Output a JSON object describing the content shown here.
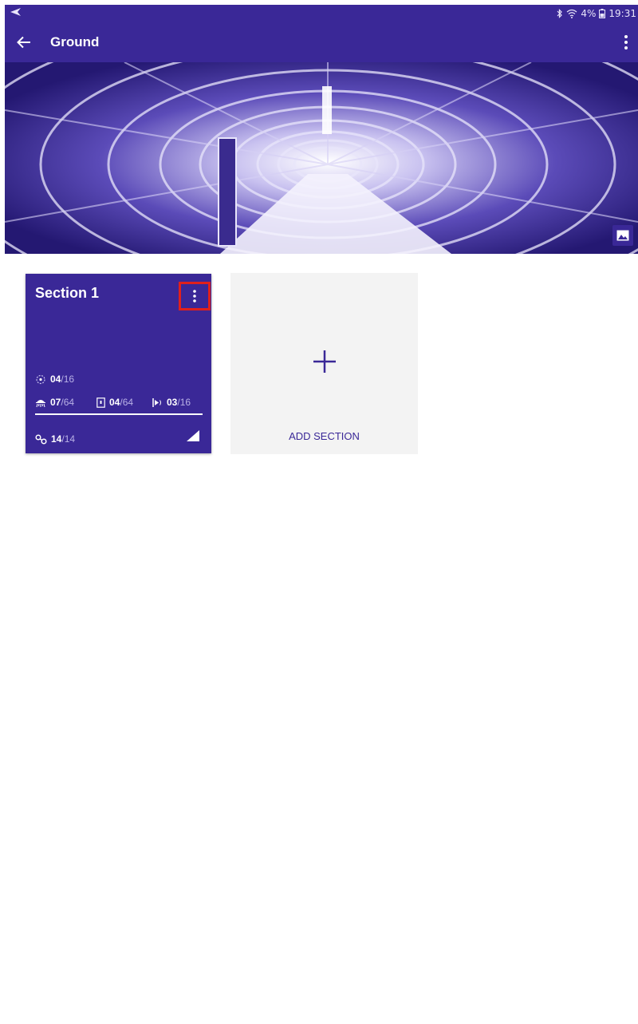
{
  "status_bar": {
    "battery": "4%",
    "time": "19:31"
  },
  "app_bar": {
    "title": "Ground"
  },
  "colors": {
    "primary": "#3a2897",
    "highlight": "#e0201c",
    "add_tile_bg": "#f3f3f3"
  },
  "section_card": {
    "title": "Section 1",
    "stats": [
      {
        "icon": "camera-icon",
        "current": "04",
        "total": "/16"
      },
      {
        "icon": "sprinkler-icon",
        "current": "07",
        "total": "/64"
      },
      {
        "icon": "door-icon",
        "current": "04",
        "total": "/64"
      },
      {
        "icon": "siren-icon",
        "current": "03",
        "total": "/16"
      },
      {
        "icon": "link-icon",
        "current": "14",
        "total": "/14"
      }
    ]
  },
  "add_section": {
    "label": "ADD SECTION"
  }
}
